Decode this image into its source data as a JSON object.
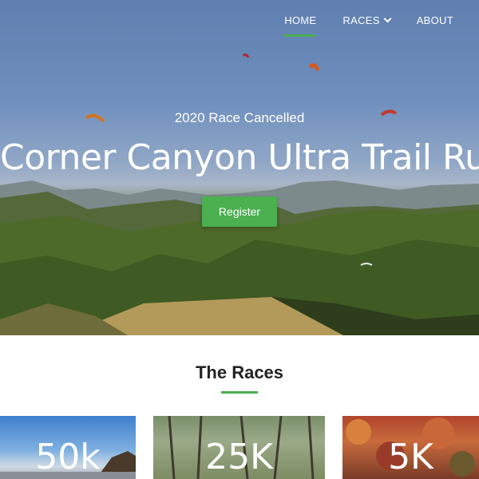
{
  "nav": {
    "items": [
      {
        "label": "HOME",
        "active": true
      },
      {
        "label": "RACES",
        "dropdown": true
      },
      {
        "label": "ABOUT"
      }
    ]
  },
  "hero": {
    "kicker": "2020 Race Cancelled",
    "title": "Corner Canyon Ultra Trail Run",
    "register_label": "Register"
  },
  "races_section": {
    "title": "The Races",
    "cards": [
      {
        "label": "50k"
      },
      {
        "label": "25K"
      },
      {
        "label": "5K"
      }
    ]
  },
  "colors": {
    "accent": "#4caf50",
    "text_dark": "#222222",
    "white": "#ffffff"
  }
}
